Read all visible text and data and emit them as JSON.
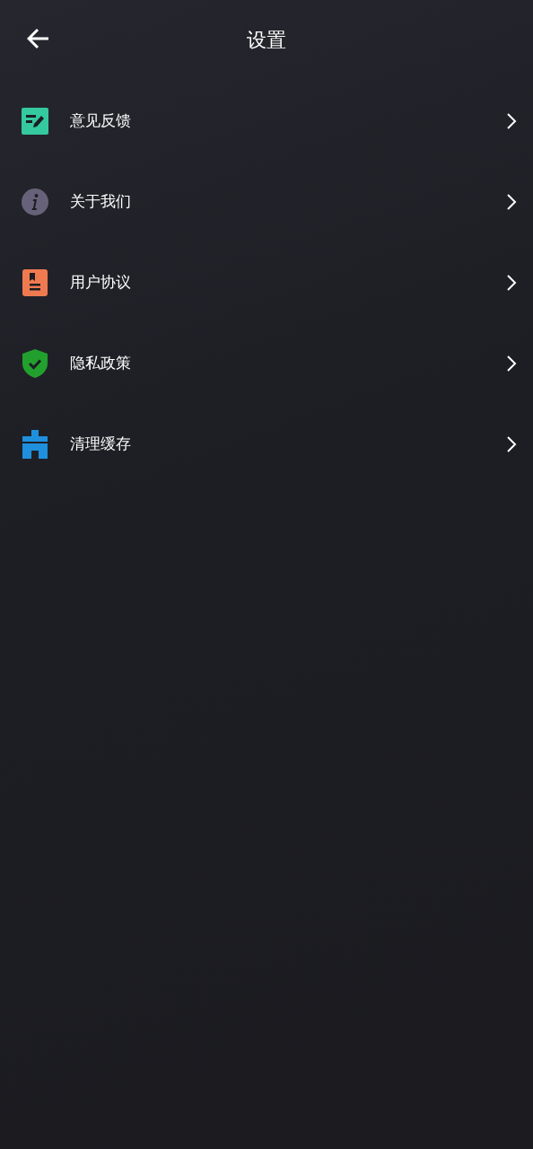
{
  "header": {
    "title": "设置"
  },
  "items": [
    {
      "kind": "feedback",
      "label": "意见反馈"
    },
    {
      "kind": "about",
      "label": "关于我们"
    },
    {
      "kind": "agreement",
      "label": "用户协议"
    },
    {
      "kind": "privacy",
      "label": "隐私政策"
    },
    {
      "kind": "cache",
      "label": "清理缓存"
    }
  ]
}
